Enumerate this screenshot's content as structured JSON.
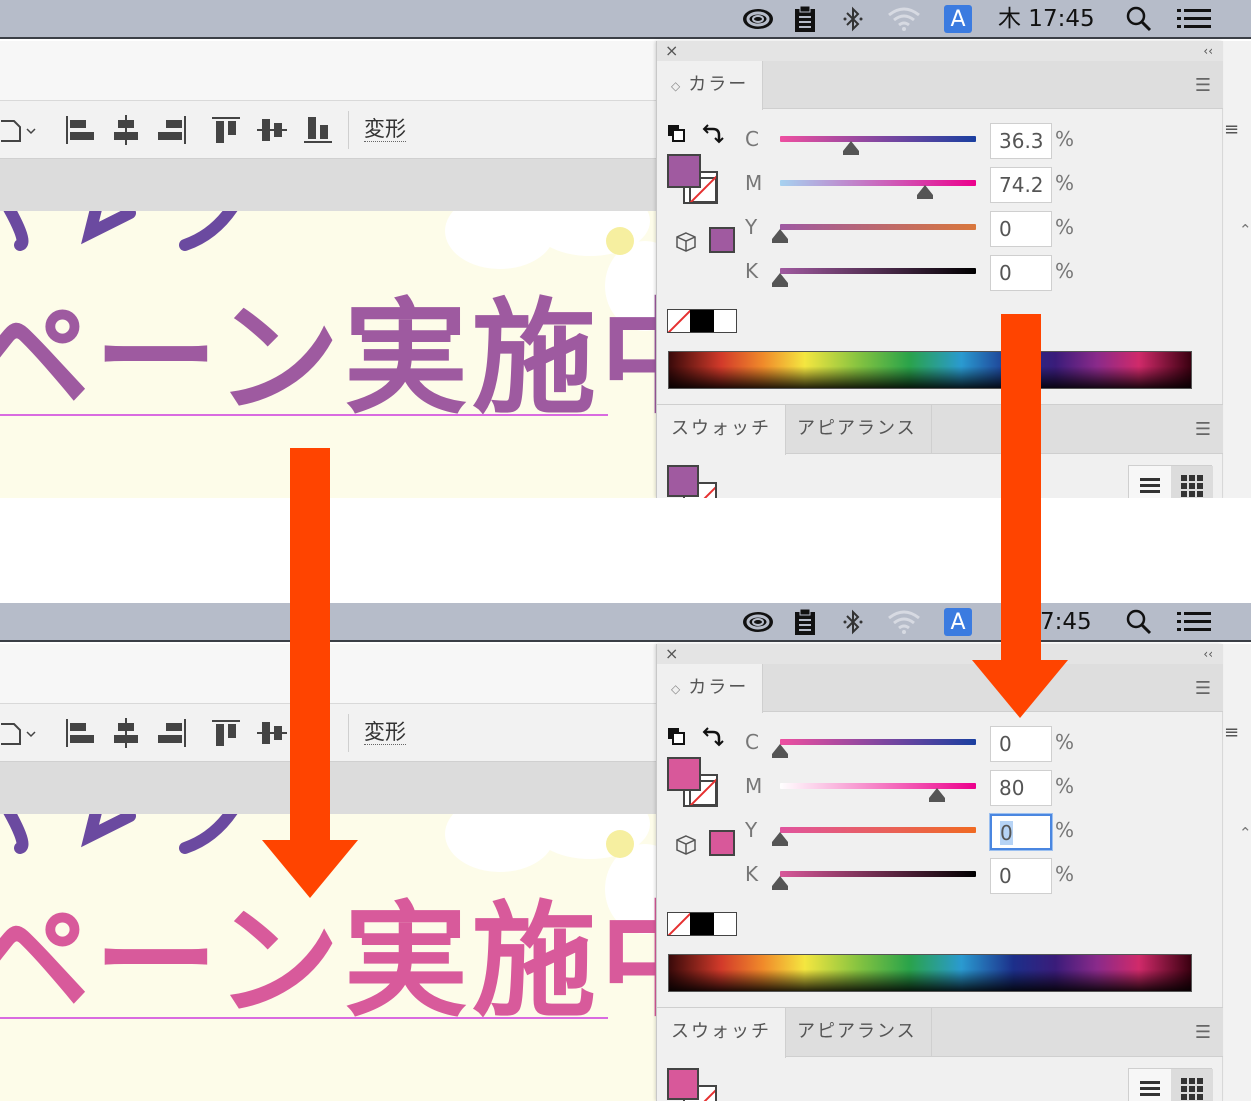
{
  "menubar": {
    "time": "木 17:45",
    "time_partial": "7:45",
    "input_method_label": "A",
    "icons": [
      "creative-cloud-icon",
      "clipboard-icon",
      "bluetooth-icon",
      "wifi-icon",
      "input-method-icon",
      "search-icon",
      "list-menu-icon"
    ]
  },
  "toolbar": {
    "transform_label": "変形",
    "icons": [
      "artboard-dropdown-icon",
      "align-left-icon",
      "align-center-horizontal-icon",
      "align-right-icon",
      "align-top-icon",
      "align-center-vertical-icon",
      "align-bottom-icon"
    ]
  },
  "artboard": {
    "headline": "ペーン実施中",
    "before_color": "#9e5aa0",
    "after_color": "#d85a9b",
    "top_glyph_color": "#6b4aa0"
  },
  "color_panel": {
    "tab_label": "カラー",
    "close_glyph": "×",
    "collapse_glyph": "‹‹",
    "percent_sign": "%",
    "before": {
      "fill_color": "#a05aa0",
      "channels": [
        {
          "label": "C",
          "value": "36.3",
          "fraction": 0.363
        },
        {
          "label": "M",
          "value": "74.2",
          "fraction": 0.742
        },
        {
          "label": "Y",
          "value": "0",
          "fraction": 0
        },
        {
          "label": "K",
          "value": "0",
          "fraction": 0
        }
      ]
    },
    "after": {
      "fill_color": "#d8589a",
      "channels": [
        {
          "label": "C",
          "value": "0",
          "fraction": 0
        },
        {
          "label": "M",
          "value": "80",
          "fraction": 0.8
        },
        {
          "label": "Y",
          "value": "0",
          "fraction": 0,
          "focused": true
        },
        {
          "label": "K",
          "value": "0",
          "fraction": 0
        }
      ]
    }
  },
  "lower_panel": {
    "tabs": [
      "スウォッチ",
      "アピアランス"
    ]
  },
  "annotation": {
    "arrow_color": "#ff4400"
  }
}
